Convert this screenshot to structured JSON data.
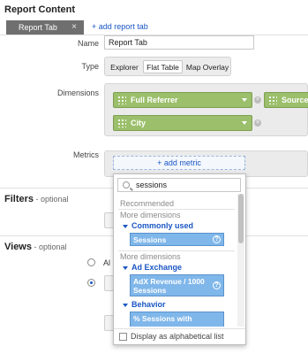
{
  "header": {
    "title": "Report Content"
  },
  "tabs": {
    "active_label": "Report Tab",
    "close_glyph": "×",
    "add_label": "+ add report tab"
  },
  "form": {
    "name_label": "Name",
    "name_value": "Report Tab",
    "type_label": "Type",
    "type_options": [
      "Explorer",
      "Flat Table",
      "Map Overlay"
    ],
    "type_selected": "Flat Table",
    "dimensions_label": "Dimensions",
    "dimension_chips": [
      "Full Referrer",
      "Source",
      "City"
    ],
    "metrics_label": "Metrics",
    "add_metric_label": "+ add metric"
  },
  "filters": {
    "title": "Filters",
    "sub": " - optional"
  },
  "views": {
    "title": "Views",
    "sub": " - optional",
    "radio_label_partial": "Al"
  },
  "metric_dropdown": {
    "search_value": "sessions",
    "recommended_header": "Recommended",
    "sections": [
      {
        "header": "More dimensions",
        "group": "Commonly used",
        "item": "Sessions"
      },
      {
        "header": "More dimensions",
        "group": "Ad Exchange",
        "item": "AdX Revenue / 1000 Sessions"
      },
      {
        "header": "",
        "group": "Behavior",
        "item": "% Sessions with"
      }
    ],
    "help_glyph": "?",
    "checkbox_label": "Display as alphabetical list"
  },
  "colors": {
    "chip": "#9bbf6b",
    "link": "#1a56c5",
    "highlight": "#80b7ea",
    "tab": "#6f6f6f"
  }
}
